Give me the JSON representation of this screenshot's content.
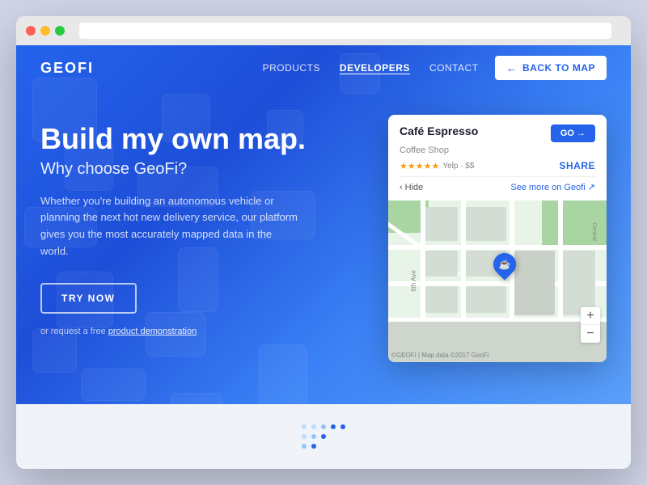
{
  "browser": {
    "traffic_lights": [
      "red",
      "yellow",
      "green"
    ]
  },
  "nav": {
    "logo": "GEOFI",
    "links": [
      {
        "label": "PRODUCTS",
        "active": false
      },
      {
        "label": "DEVELOPERS",
        "active": true
      },
      {
        "label": "CONTACT",
        "active": false
      }
    ],
    "back_to_map": "BACK TO MAP"
  },
  "hero": {
    "title": "Build my own map.",
    "subtitle": "Why choose GeoFi?",
    "description": "Whether you're building an autonomous vehicle or planning the next hot new delivery service, our platform gives you the most accurately mapped data in the world.",
    "try_now_label": "TRY NOW",
    "free_demo_prefix": "or request a free ",
    "free_demo_link": "product demonstration"
  },
  "map_card": {
    "place_name": "Café Espresso",
    "place_type": "Coffee Shop",
    "go_label": "GO →",
    "stars": "★★★★★",
    "review_source": "Yelp · $$",
    "share_label": "SHARE",
    "hide_label": "Hide",
    "see_more_label": "See more on Geofi ↗",
    "zoom_in": "+",
    "zoom_out": "−",
    "watermark": "©GEOFI | Map data ©2017 GeoFi"
  }
}
